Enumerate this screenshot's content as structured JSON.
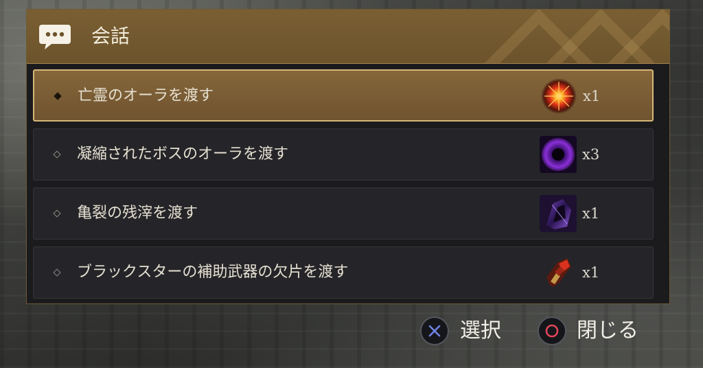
{
  "dialog": {
    "title": "会話",
    "title_icon": "speech-bubble-icon",
    "options": [
      {
        "label": "亡霊のオーラを渡す",
        "count": "x1",
        "icon": "ghost-aura-icon",
        "selected": true
      },
      {
        "label": "凝縮されたボスのオーラを渡す",
        "count": "x3",
        "icon": "condensed-boss-aura-icon",
        "selected": false
      },
      {
        "label": "亀裂の残滓を渡す",
        "count": "x1",
        "icon": "rift-remnant-icon",
        "selected": false
      },
      {
        "label": "ブラックスターの補助武器の欠片を渡す",
        "count": "x1",
        "icon": "blackstar-sub-weapon-shard-icon",
        "selected": false
      }
    ]
  },
  "controls": {
    "select": {
      "label": "選択",
      "icon": "cross-button-icon"
    },
    "close": {
      "label": "閉じる",
      "icon": "circle-button-icon"
    }
  },
  "colors": {
    "header": "#7a5f33",
    "selected_row": "#86663a",
    "selected_border": "#d6b878",
    "row": "#252529",
    "panel": "#1b1b1e",
    "cross_accent": "#6f82e0",
    "circle_accent": "#e0455a"
  }
}
